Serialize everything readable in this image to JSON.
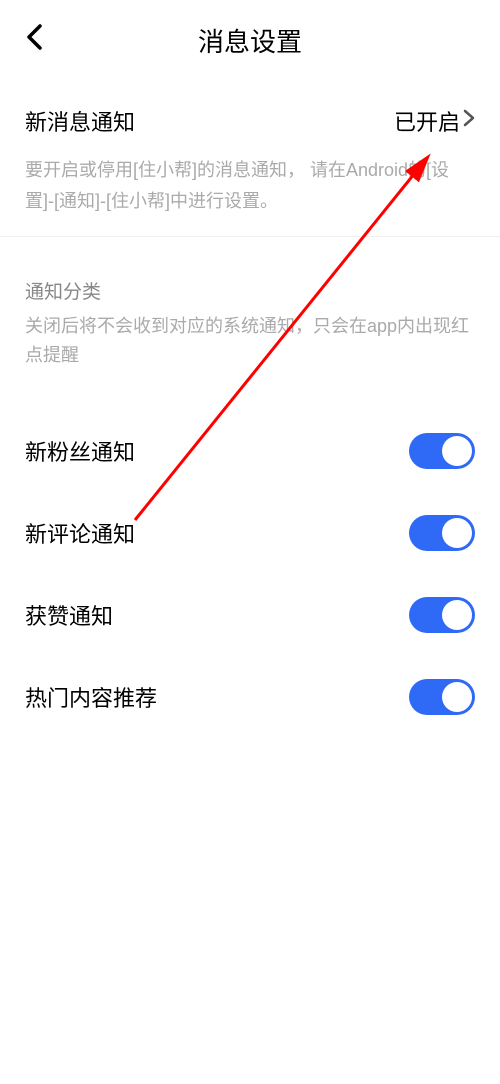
{
  "header": {
    "title": "消息设置"
  },
  "notification": {
    "label": "新消息通知",
    "status": "已开启",
    "description": "要开启或停用[住小帮]的消息通知， 请在Android的[设置]-[通知]-[住小帮]中进行设置。"
  },
  "category": {
    "title": "通知分类",
    "description": "关闭后将不会收到对应的系统通知，只会在app内出现红点提醒"
  },
  "toggles": {
    "new_fans": {
      "label": "新粉丝通知",
      "enabled": true
    },
    "new_comment": {
      "label": "新评论通知",
      "enabled": true
    },
    "likes": {
      "label": "获赞通知",
      "enabled": true
    },
    "hot_content": {
      "label": "热门内容推荐",
      "enabled": true
    }
  },
  "colors": {
    "toggle_on": "#2f6af6",
    "arrow": "#ff0000"
  }
}
